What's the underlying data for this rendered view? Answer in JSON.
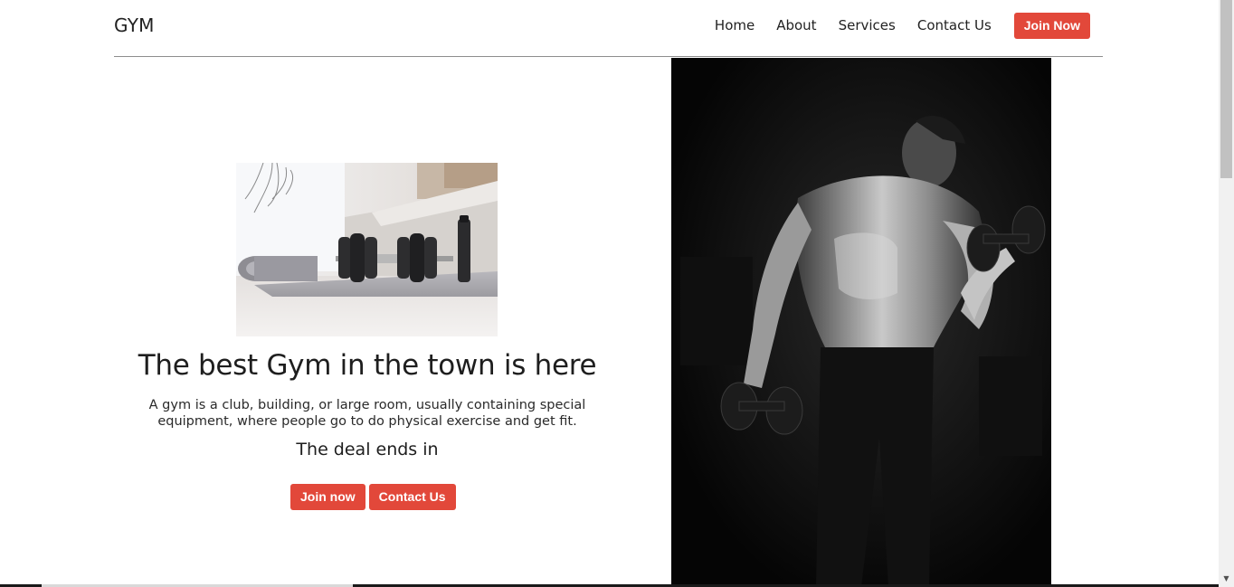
{
  "header": {
    "brand": "GYM",
    "nav": [
      {
        "label": "Home"
      },
      {
        "label": "About"
      },
      {
        "label": "Services"
      },
      {
        "label": "Contact Us"
      }
    ],
    "cta_label": "Join Now"
  },
  "hero": {
    "title": "The best Gym in the town is here",
    "description": "A gym is a club, building, or large room, usually containing special equipment, where people go to do physical exercise and get fit.",
    "deal_text": "The deal ends in",
    "buttons": {
      "join": "Join now",
      "contact": "Contact Us"
    },
    "images": {
      "left": "dumbbells-on-yoga-mat-photo",
      "right": "bodybuilder-lifting-dumbbells-photo"
    }
  },
  "theme": {
    "accent": "#e2483a",
    "text": "#1f1f1f",
    "right_panel_bg": "#050505"
  }
}
